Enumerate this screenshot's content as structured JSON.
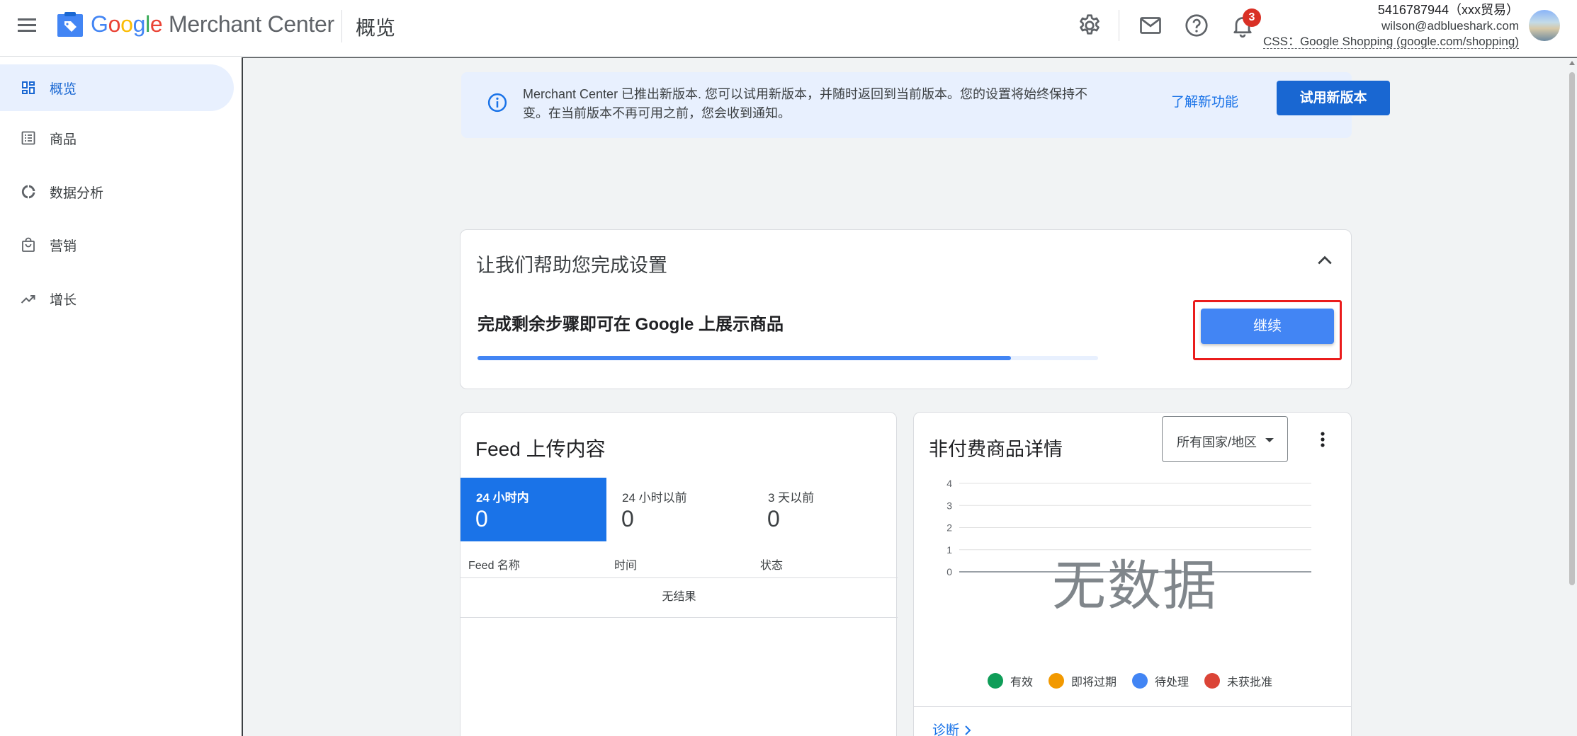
{
  "header": {
    "brand": "Google Merchant Center",
    "breadcrumb": "概览",
    "notification_count": "3",
    "account_line1": "5416787944（xxx贸易）",
    "account_line2": "wilson@adblueshark.com",
    "account_line3": "CSS：Google Shopping (google.com/shopping)"
  },
  "sidebar": {
    "items": [
      {
        "label": "概览",
        "icon": "dashboard-icon",
        "active": true
      },
      {
        "label": "商品",
        "icon": "list-icon"
      },
      {
        "label": "数据分析",
        "icon": "analytics-icon"
      },
      {
        "label": "营销",
        "icon": "shopping-bag-icon"
      },
      {
        "label": "增长",
        "icon": "trending-up-icon"
      }
    ]
  },
  "banner": {
    "message": "Merchant Center 已推出新版本. 您可以试用新版本，并随时返回到当前版本。您的设置将始终保持不变。在当前版本不再可用之前，您会收到通知。",
    "learn_link": "了解新功能",
    "try_button": "试用新版本"
  },
  "setup": {
    "title": "让我们帮助您完成设置",
    "subtitle": "完成剩余步骤即可在 Google 上展示商品",
    "progress": 0.86,
    "continue_button": "继续"
  },
  "feed": {
    "title": "Feed 上传内容",
    "tabs": [
      {
        "label": "24 小时内",
        "value": "0",
        "active": true
      },
      {
        "label": "24 小时以前",
        "value": "0"
      },
      {
        "label": "3 天以前",
        "value": "0"
      }
    ],
    "columns": [
      "Feed 名称",
      "时间",
      "状态"
    ],
    "empty_text": "无结果"
  },
  "unpaid": {
    "title": "非付费商品详情",
    "dropdown_value": "所有国家/地区",
    "no_data": "无数据",
    "diagnose_link": "诊断",
    "colors": {
      "active": "#0f9d58",
      "expiring": "#f29900",
      "pending": "#4285f4",
      "disapproved": "#db4437"
    }
  },
  "chart_data": {
    "type": "line",
    "title": "",
    "xlabel": "",
    "ylabel": "",
    "y_ticks": [
      "4",
      "3",
      "2",
      "1",
      "0"
    ],
    "ylim": [
      0,
      4
    ],
    "grid": true,
    "legend_position": "bottom",
    "series": [
      {
        "name": "有效",
        "values": []
      },
      {
        "name": "即将过期",
        "values": []
      },
      {
        "name": "待处理",
        "values": []
      },
      {
        "name": "未获批准",
        "values": []
      }
    ]
  }
}
